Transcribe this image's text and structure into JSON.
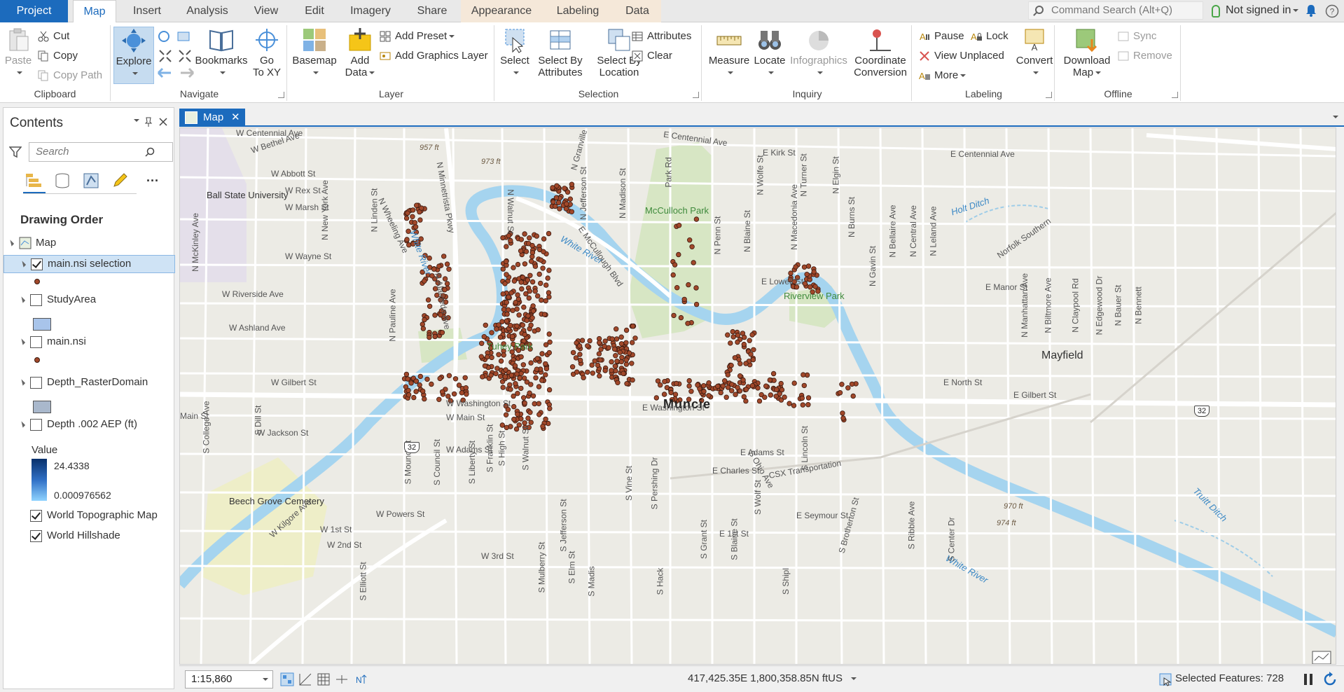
{
  "ribbon_tabs": [
    "Project",
    "Map",
    "Insert",
    "Analysis",
    "View",
    "Edit",
    "Imagery",
    "Share",
    "Appearance",
    "Labeling",
    "Data"
  ],
  "command_search_placeholder": "Command Search (Alt+Q)",
  "signin_label": "Not signed in",
  "clipboard": {
    "title": "Clipboard",
    "paste": "Paste",
    "cut": "Cut",
    "copy": "Copy",
    "copy_path": "Copy Path"
  },
  "navigate": {
    "title": "Navigate",
    "explore": "Explore",
    "bookmarks": "Bookmarks",
    "goto1": "Go",
    "goto2": "To XY"
  },
  "layer": {
    "title": "Layer",
    "basemap": "Basemap",
    "add1": "Add",
    "add2": "Data",
    "add_preset": "Add Preset",
    "add_graphics": "Add Graphics Layer"
  },
  "selection": {
    "title": "Selection",
    "select": "Select",
    "sba1": "Select By",
    "sba2": "Attributes",
    "sbl1": "Select By",
    "sbl2": "Location",
    "attributes": "Attributes",
    "clear": "Clear"
  },
  "inquiry": {
    "title": "Inquiry",
    "measure": "Measure",
    "locate": "Locate",
    "infographics": "Infographics",
    "coord1": "Coordinate",
    "coord2": "Conversion"
  },
  "labeling": {
    "title": "Labeling",
    "pause": "Pause",
    "lock": "Lock",
    "view_unplaced": "View Unplaced",
    "more": "More",
    "convert": "Convert"
  },
  "offline": {
    "title": "Offline",
    "download1": "Download",
    "download2": "Map",
    "sync": "Sync",
    "remove": "Remove"
  },
  "contents": {
    "title": "Contents",
    "search_placeholder": "Search",
    "drawing_order": "Drawing Order",
    "map_label": "Map",
    "layers": [
      {
        "name": "main.nsi selection",
        "checked": true
      },
      {
        "name": "StudyArea",
        "checked": false
      },
      {
        "name": "main.nsi",
        "checked": false
      },
      {
        "name": "Depth_RasterDomain",
        "checked": false
      },
      {
        "name": "Depth .002 AEP (ft)",
        "checked": false
      }
    ],
    "value_label": "Value",
    "value_max": "24.4338",
    "value_min": "0.000976562",
    "basemaps": [
      {
        "name": "World Topographic Map",
        "checked": true
      },
      {
        "name": "World Hillshade",
        "checked": true
      }
    ],
    "colors": {
      "selection_dot": "#a1482a",
      "studyarea_fill": "#a8c4ea",
      "raster_fill": "#a9b8cc",
      "depth_high": "#08306b",
      "depth_low": "#8fd3ff"
    }
  },
  "map_tab_label": "Map",
  "map": {
    "city": "Muncie",
    "places": [
      "Ball State University",
      "McCulloch Park",
      "Riverview Park",
      "Tuhey Park",
      "Beech Grove Cemetery",
      "Mayfield"
    ],
    "water": [
      "White River",
      "White River",
      "White River",
      "Holt Ditch",
      "Norfolk Southern",
      "Truitt Ditch"
    ],
    "streets": [
      "W Centennial Ave",
      "E Centennial Ave",
      "E Centennial Ave",
      "W Bethel Ave",
      "W Abbott St",
      "W Rex St",
      "W Marsh St",
      "W Wayne St",
      "W Riverside Ave",
      "W Ashland Ave",
      "W Gilbert St",
      "Main St",
      "W Jackson St",
      "W Main St",
      "W Washington St",
      "W Adams St",
      "E Adams St",
      "E Charles St",
      "CSX Transportation",
      "E Seymour St",
      "W Powers St",
      "W 1st St",
      "W 2nd St",
      "W 3rd St",
      "E 1st St",
      "E Kirk St",
      "E Lowell St",
      "E Manor St",
      "E North St",
      "E Gilbert St",
      "E Washington St",
      "N Minnetrista Pkwy",
      "N Wheeling Ave",
      "N Walnut St",
      "N Jefferson St",
      "N Madison St",
      "N Granville",
      "Park Rd",
      "E McCullough Blvd",
      "N Penn St",
      "N Blaine St",
      "N Wolfe St",
      "N Macedonia Ave",
      "N Turner St",
      "N Elgin St",
      "N Burns St",
      "N Gavin St",
      "N Bellaire Ave",
      "N Central Ave",
      "N Leland Ave",
      "N Manhattan Ave",
      "N Biltmore Ave",
      "N Claypool Rd",
      "N Edgewood Dr",
      "N Bauer St",
      "N Bennett",
      "N New York Ave",
      "N Linden St",
      "N McKinley Ave",
      "N Alameda Ave",
      "N Pauline Ave",
      "S Dill St",
      "S College Ave",
      "S Mound St",
      "S Council St",
      "S Liberty St",
      "S Franklin St",
      "S High St",
      "S Walnut St",
      "S Mulberry St",
      "S Jefferson St",
      "S Elm St",
      "S Vine St",
      "S Pershing Dr",
      "S Grant St",
      "S Blaine St",
      "S Wolf St",
      "S Ohio Ave",
      "S Lincoln St",
      "S Brotherton St",
      "S Ribble Ave",
      "S Center Dr",
      "W Kilgore Ave",
      "S Elliott St",
      "S Madis",
      "S Hack",
      "S Shipl"
    ],
    "elevations": [
      "957 ft",
      "973 ft",
      "970 ft",
      "974 ft"
    ],
    "shields": [
      "32",
      "32"
    ]
  },
  "status": {
    "scale": "1:15,860",
    "coords": "417,425.35E 1,800,358.85N ftUS",
    "selected_features": "Selected Features: 728"
  }
}
